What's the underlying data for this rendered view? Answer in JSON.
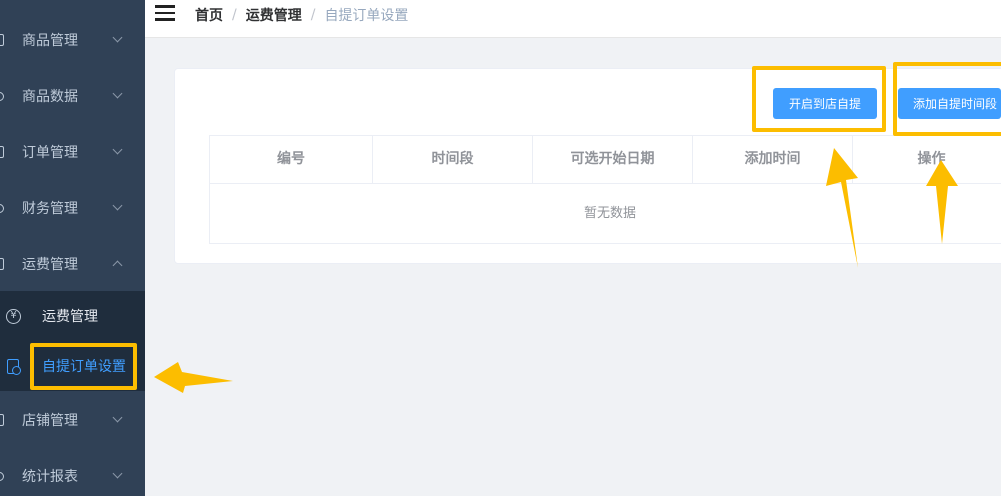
{
  "sidebar": {
    "items": [
      {
        "label": "商品管理"
      },
      {
        "label": "商品数据"
      },
      {
        "label": "订单管理"
      },
      {
        "label": "财务管理"
      },
      {
        "label": "运费管理"
      },
      {
        "label": "店铺管理"
      },
      {
        "label": "统计报表"
      }
    ],
    "submenu": [
      {
        "label": "运费管理",
        "icon": "¥"
      },
      {
        "label": "自提订单设置"
      }
    ]
  },
  "breadcrumb": {
    "home": "首页",
    "parent": "运费管理",
    "current": "自提订单设置",
    "separator": "/"
  },
  "actions": {
    "open_label": "开启到店自提",
    "add_label": "添加自提时间段"
  },
  "table": {
    "columns": [
      "编号",
      "时间段",
      "可选开始日期",
      "添加时间",
      "操作"
    ],
    "empty_text": "暂无数据"
  },
  "colors": {
    "sidebar_bg": "#304156",
    "submenu_bg": "#1f2d3d",
    "primary": "#409eff",
    "highlight": "#fcbd00"
  }
}
